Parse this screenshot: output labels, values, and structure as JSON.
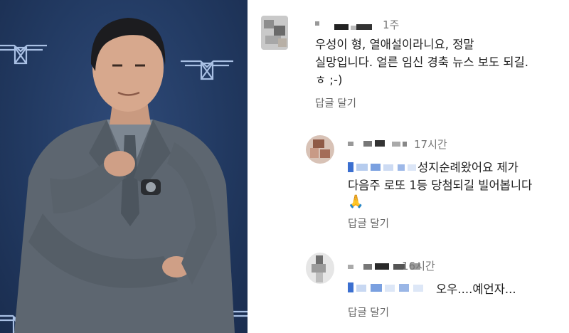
{
  "comments": [
    {
      "time": "1주",
      "lines": [
        "우성이 형, 열애설이라니요, 정말",
        "실망입니다. 얼른 임신 경축 뉴스 보도 되길.",
        "ㅎ ;-)"
      ],
      "reply_label": "답글 달기"
    },
    {
      "time": "17시간",
      "lines": [
        "성지순례왔어요 제가",
        "다음주 로또 1등 당첨되길 빌어봅니다"
      ],
      "emoji": "🙏",
      "reply_label": "답글 달기"
    },
    {
      "time": "16시간",
      "lines": [
        "오우....예언자..."
      ],
      "reply_label": "답글 달기"
    }
  ],
  "icons": {
    "praying_hands": "praying-hands-icon",
    "brand_logo": "winged-hourglass-logo"
  }
}
